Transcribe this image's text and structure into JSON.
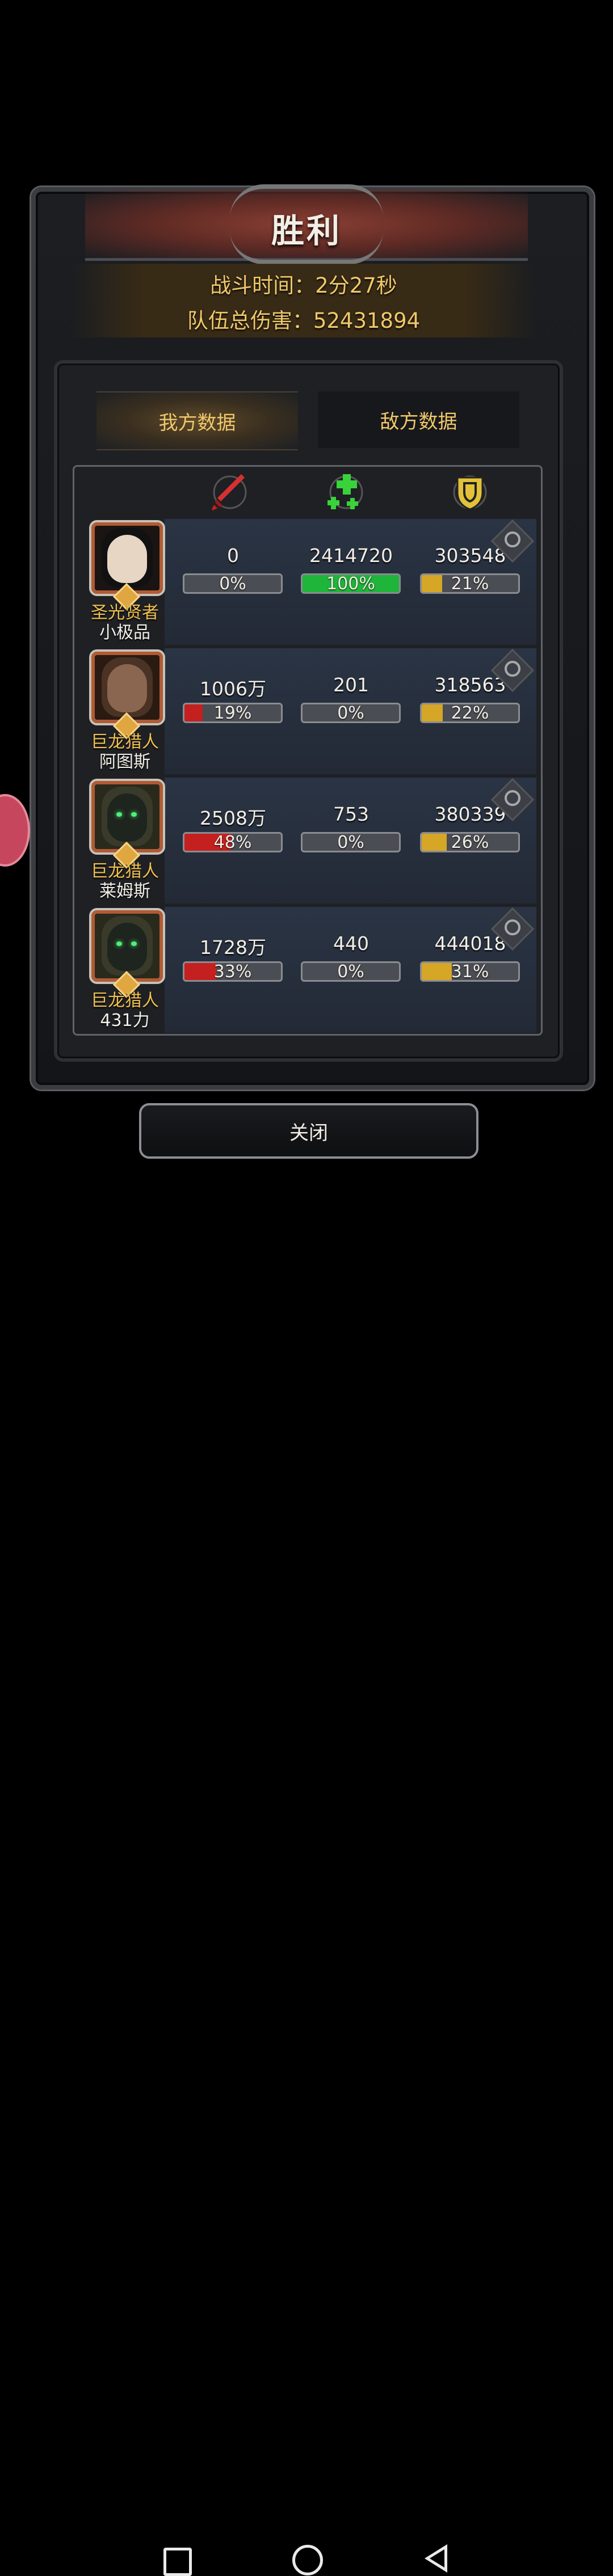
{
  "dialog": {
    "title": "胜利",
    "battle_time": "战斗时间：2分27秒",
    "total_damage": "队伍总伤害：52431894"
  },
  "tabs": [
    {
      "label": "我方数据",
      "active": true
    },
    {
      "label": "敌方数据",
      "active": false
    }
  ],
  "columns": [
    {
      "icon": "sword-damage-icon",
      "color": "#d83030"
    },
    {
      "icon": "heal-cross-icon",
      "color": "#3ad23a"
    },
    {
      "icon": "shield-tank-icon",
      "color": "#e2c23a"
    }
  ],
  "rows": [
    {
      "class": "圣光贤者",
      "name": "小极品",
      "avatar": "nun-portrait",
      "damage": "0",
      "damage_pct": "0%",
      "damage_frac": 0,
      "heal": "2414720",
      "heal_pct": "100%",
      "heal_frac": 1.0,
      "tank": "303548",
      "tank_pct": "21%",
      "tank_frac": 0.21
    },
    {
      "class": "巨龙猎人",
      "name": "阿图斯",
      "avatar": "hunter-hat-portrait",
      "damage": "1006万",
      "damage_pct": "19%",
      "damage_frac": 0.19,
      "heal": "201",
      "heal_pct": "0%",
      "heal_frac": 0,
      "tank": "318563",
      "tank_pct": "22%",
      "tank_frac": 0.22
    },
    {
      "class": "巨龙猎人",
      "name": "莱姆斯",
      "avatar": "hooded-portrait",
      "damage": "2508万",
      "damage_pct": "48%",
      "damage_frac": 0.48,
      "heal": "753",
      "heal_pct": "0%",
      "heal_frac": 0,
      "tank": "380339",
      "tank_pct": "26%",
      "tank_frac": 0.26
    },
    {
      "class": "巨龙猎人",
      "name": "431力",
      "avatar": "hooded-portrait",
      "damage": "1728万",
      "damage_pct": "33%",
      "damage_frac": 0.33,
      "heal": "440",
      "heal_pct": "0%",
      "heal_frac": 0,
      "tank": "444018",
      "tank_pct": "31%",
      "tank_frac": 0.31
    }
  ],
  "close_label": "关闭",
  "colors": {
    "damage": "#c42020",
    "heal": "#1fb43a",
    "tank": "#d6a626",
    "gold_text": "#f0c86a"
  }
}
